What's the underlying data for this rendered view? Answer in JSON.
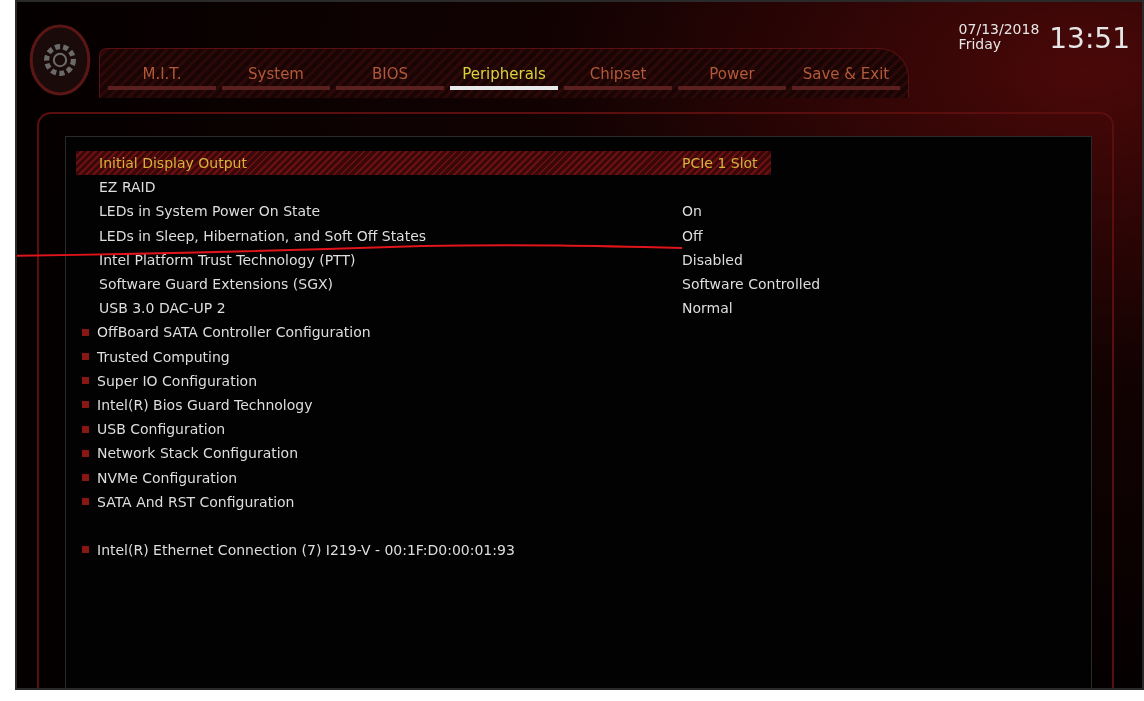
{
  "tabs": [
    {
      "label": "M.I.T.",
      "selected": false
    },
    {
      "label": "System",
      "selected": false
    },
    {
      "label": "BIOS",
      "selected": false
    },
    {
      "label": "Peripherals",
      "selected": true
    },
    {
      "label": "Chipset",
      "selected": false
    },
    {
      "label": "Power",
      "selected": false
    },
    {
      "label": "Save & Exit",
      "selected": false
    }
  ],
  "clock": {
    "date": "07/13/2018",
    "weekday": "Friday",
    "time": "13:51"
  },
  "settings": [
    {
      "kind": "setting",
      "label": "Initial Display Output",
      "value": "PCIe 1 Slot",
      "selected": true
    },
    {
      "kind": "setting",
      "label": "EZ RAID",
      "selected": false
    },
    {
      "kind": "setting",
      "label": "LEDs in System Power On State",
      "value": "On",
      "selected": false
    },
    {
      "kind": "setting",
      "label": "LEDs in Sleep, Hibernation, and Soft Off States",
      "value": "Off",
      "selected": false
    },
    {
      "kind": "setting",
      "label": "Intel Platform Trust Technology (PTT)",
      "value": "Disabled",
      "selected": false
    },
    {
      "kind": "setting",
      "label": "Software Guard Extensions (SGX)",
      "value": "Software Controlled",
      "selected": false
    },
    {
      "kind": "setting",
      "label": "USB 3.0 DAC-UP 2",
      "value": "Normal",
      "selected": false
    },
    {
      "kind": "submenu",
      "label": "OffBoard SATA Controller Configuration",
      "selected": false
    },
    {
      "kind": "submenu",
      "label": "Trusted Computing",
      "selected": false
    },
    {
      "kind": "submenu",
      "label": "Super IO Configuration",
      "selected": false
    },
    {
      "kind": "submenu",
      "label": "Intel(R) Bios Guard Technology",
      "selected": false
    },
    {
      "kind": "submenu",
      "label": "USB Configuration",
      "selected": false
    },
    {
      "kind": "submenu",
      "label": "Network Stack Configuration",
      "selected": false
    },
    {
      "kind": "submenu",
      "label": "NVMe Configuration",
      "selected": false
    },
    {
      "kind": "submenu",
      "label": "SATA And RST Configuration",
      "selected": false
    },
    {
      "kind": "device",
      "label": "Intel(R) Ethernet Connection (7) I219-V - 00:1F:D0:00:01:93",
      "selected": false
    }
  ]
}
